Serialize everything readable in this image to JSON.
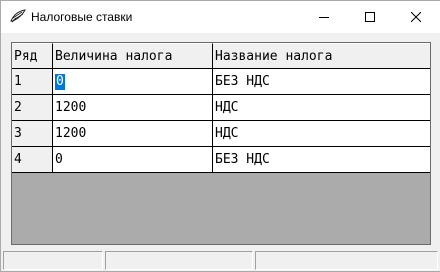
{
  "window": {
    "title": "Налоговые ставки",
    "icon": "app-feather-icon",
    "controls": {
      "minimize": "minimize-icon",
      "maximize": "maximize-icon",
      "close": "close-icon"
    }
  },
  "grid": {
    "headers": [
      "Ряд",
      "Величина налога",
      "Название налога"
    ],
    "rows": [
      {
        "num": "1",
        "amount": "0",
        "name": "БЕЗ НДС"
      },
      {
        "num": "2",
        "amount": "1200",
        "name": "НДС"
      },
      {
        "num": "3",
        "amount": "1200",
        "name": "НДС"
      },
      {
        "num": "4",
        "amount": "0",
        "name": "БЕЗ НДС"
      }
    ],
    "selection_color": "#0078d7"
  },
  "statusbar": {
    "panels": [
      "",
      "",
      ""
    ]
  }
}
